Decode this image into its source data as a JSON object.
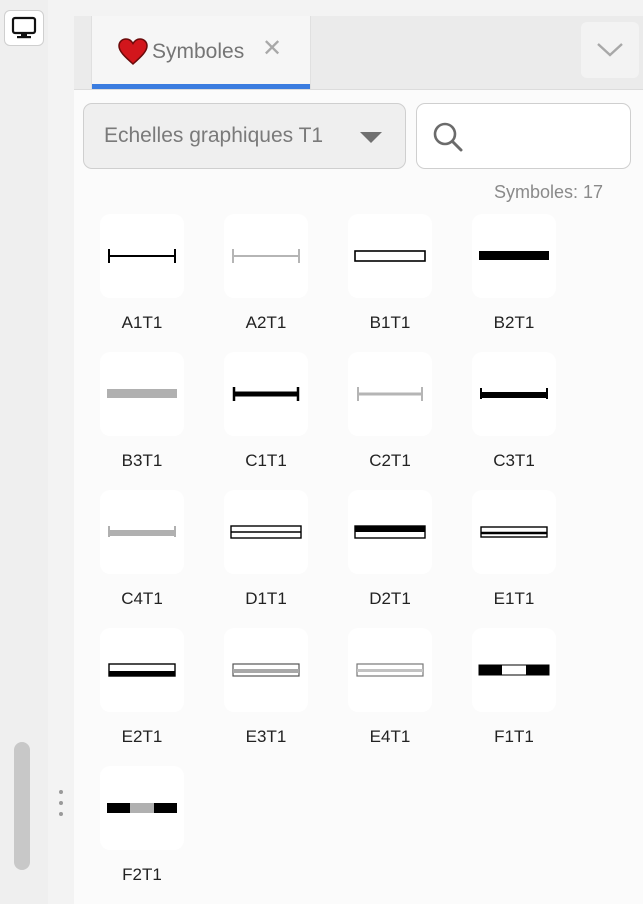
{
  "sidebar": {
    "display_icon": "monitor-icon"
  },
  "tab": {
    "label": "Symboles",
    "icon": "heart-icon",
    "close_icon": "close-icon",
    "accent": "#3b7de0"
  },
  "collapse_icon": "chevron-down-icon",
  "dropdown": {
    "value": "Echelles graphiques T1",
    "icon": "caret-down-icon"
  },
  "search": {
    "placeholder": "",
    "icon": "search-icon"
  },
  "count_text": "Symboles: 17",
  "symbols": [
    {
      "label": "A1T1",
      "style": "capped-thin-black"
    },
    {
      "label": "A2T1",
      "style": "capped-thin-gray"
    },
    {
      "label": "B1T1",
      "style": "hollow-bar"
    },
    {
      "label": "B2T1",
      "style": "thick-black-bar"
    },
    {
      "label": "B3T1",
      "style": "thick-gray-bar"
    },
    {
      "label": "C1T1",
      "style": "capped-thick-black"
    },
    {
      "label": "C2T1",
      "style": "capped-medium-gray"
    },
    {
      "label": "C3T1",
      "style": "capped-thick-black-wide"
    },
    {
      "label": "C4T1",
      "style": "capped-thick-gray"
    },
    {
      "label": "D1T1",
      "style": "double-hollow"
    },
    {
      "label": "D2T1",
      "style": "black-over-hollow"
    },
    {
      "label": "E1T1",
      "style": "hollow-black-bottom"
    },
    {
      "label": "E2T1",
      "style": "hollow-black-bottom-thick"
    },
    {
      "label": "E3T1",
      "style": "hollow-gray-fill"
    },
    {
      "label": "E4T1",
      "style": "hollow-gray-fill-light"
    },
    {
      "label": "F1T1",
      "style": "black-white-black"
    },
    {
      "label": "F2T1",
      "style": "black-gray-black"
    }
  ]
}
